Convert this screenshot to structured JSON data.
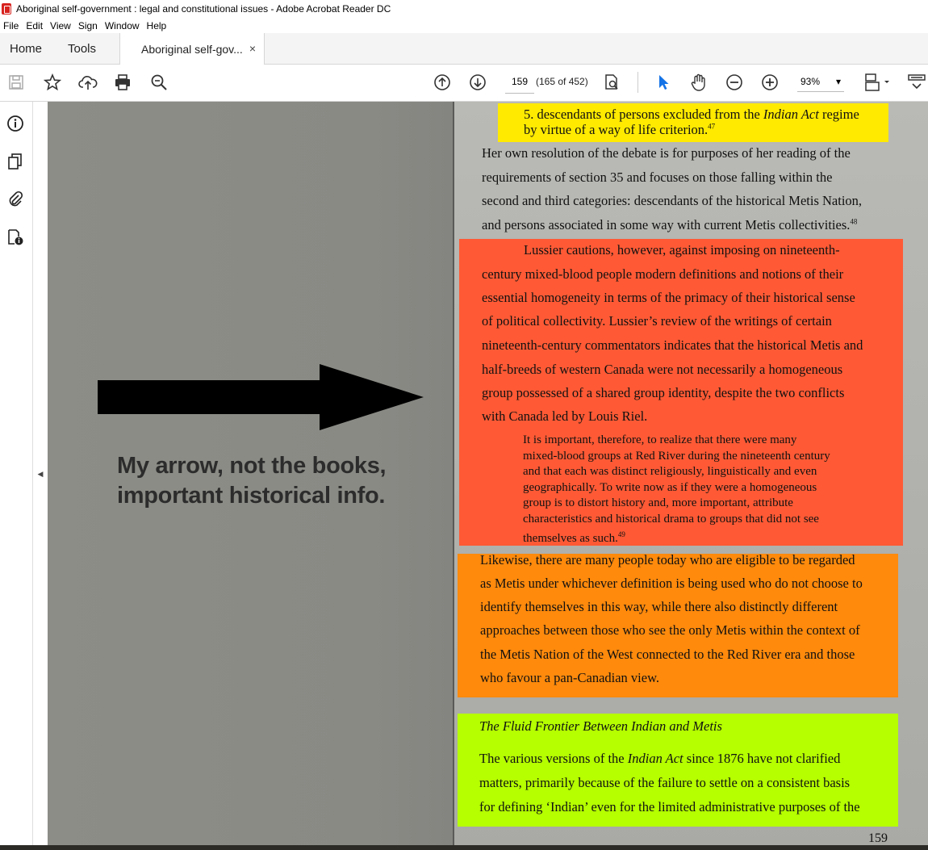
{
  "window": {
    "title": "Aboriginal self-government : legal and constitutional issues - Adobe Acrobat Reader DC"
  },
  "menu": [
    "File",
    "Edit",
    "View",
    "Sign",
    "Window",
    "Help"
  ],
  "tabs": {
    "home": "Home",
    "tools": "Tools",
    "document": "Aboriginal self-gov...",
    "close": "×"
  },
  "toolbar": {
    "page_number": "159",
    "page_count": "(165 of 452)",
    "zoom": "93%",
    "zoom_caret": "▾"
  },
  "annotation": {
    "line1": "My arrow, not the books,",
    "line2": "important historical info."
  },
  "page": {
    "yellow": {
      "line1a": "5. descendants of persons excluded from the ",
      "line1b": "Indian Act",
      "line1c": " regime",
      "line2": "by virtue of a way of life criterion.",
      "sup": "47"
    },
    "para1": [
      "Her own resolution of the debate is for purposes of her reading of the",
      "requirements of section 35 and focuses on those falling within the",
      "second and third categories: descendants of the historical Metis Nation,",
      "and persons associated in some way with current Metis collectivities."
    ],
    "para1_sup": "48",
    "red_para": [
      "Lussier cautions, however, against imposing on nineteenth-",
      "century mixed-blood people modern definitions and notions of their",
      "essential homogeneity in terms of the primacy of their historical sense",
      "of political collectivity. Lussier’s review of the writings of certain",
      "nineteenth-century commentators indicates that the historical Metis and",
      "half-breeds of western Canada were not necessarily a homogeneous",
      "group possessed of a shared group identity, despite the two conflicts",
      "with Canada led by Louis Riel."
    ],
    "block_quote": [
      "It is important, therefore, to realize that there were many",
      "mixed-blood groups at Red River during the nineteenth century",
      "and that each was distinct religiously, linguistically and even",
      "geographically. To write now as if they were a homogeneous",
      "group is to distort history and, more important, attribute",
      "characteristics and historical drama to groups that did not see",
      "themselves as such."
    ],
    "block_quote_sup": "49",
    "orange_para": [
      "Likewise, there are many people today who are eligible to be regarded",
      "as Metis under whichever definition is being used who do not choose to",
      "identify themselves in this way, while there also distinctly different",
      "approaches between those who see the only Metis within the context of",
      "the Metis Nation of the West connected to the Red River era and those",
      "who favour a pan-Canadian view."
    ],
    "heading": "The Fluid Frontier Between Indian and Metis",
    "green_line1a": "The various versions of the ",
    "green_line1b": "Indian Act",
    "green_line1c": " since 1876 have not clarified",
    "green_lines": [
      "matters, primarily because of the failure to settle on a consistent basis",
      "for defining ‘Indian’ even for the limited administrative purposes of the"
    ],
    "page_number": "159"
  },
  "colors": {
    "yellow_highlight": "#ffea00",
    "red_highlight": "#ff5a35",
    "orange_highlight": "#ff8a0c",
    "green_highlight": "#b5ff00",
    "select_tool": "#1473e6"
  }
}
